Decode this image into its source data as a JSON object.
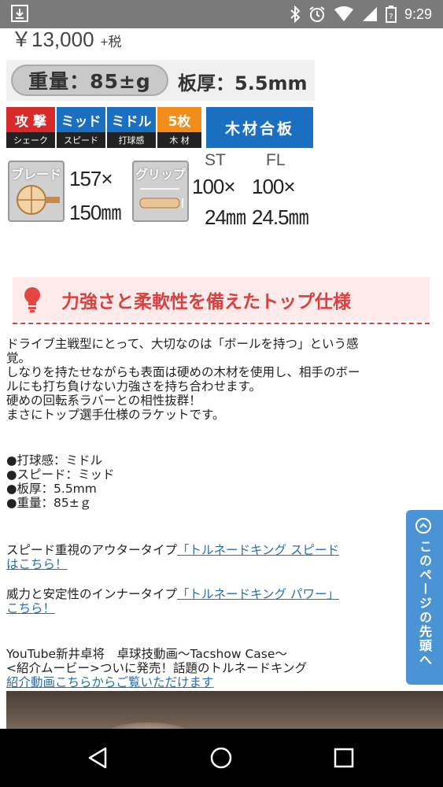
{
  "status_bar": {
    "time": "9:29"
  },
  "product": {
    "price": "￥13,000",
    "tax": "+税"
  },
  "spec": {
    "weight": "重量：85±g",
    "thickness": "板厚：5.5mm",
    "badges": [
      {
        "top": "攻 撃",
        "bottom": "シェーク"
      },
      {
        "top": "ミッド",
        "bottom": "スピード"
      },
      {
        "top": "ミドル",
        "bottom": "打球感"
      },
      {
        "top": "5枚",
        "bottom": "木 材"
      }
    ],
    "wood_label": "木材合板",
    "blade_label": "ブレード",
    "blade_w": "157×",
    "blade_h": "150㎜",
    "grip_label": "グリップ",
    "st_label": "ST",
    "fl_label": "FL",
    "st_w": "100×",
    "st_h": "24㎜",
    "fl_w": "100×",
    "fl_h": "24.5㎜"
  },
  "heading": {
    "title": "力強さと柔軟性を備えたトップ仕様"
  },
  "description": [
    "ドライブ主戦型にとって、大切なのは「ボールを持つ」という感",
    "覚。",
    "しなりを持たせながらも表面は硬めの木材を使用し、相手のボー",
    "ルにも打ち負けない力強さを持ち合わせます。",
    "硬めの回転系ラバーとの相性抜群！",
    "まさにトップ選手仕様のラケットです。"
  ],
  "specs_list": [
    "●打球感：ミドル",
    "●スピード：ミッド",
    "●板厚：5.5mm",
    "●重量：85±ｇ"
  ],
  "links": {
    "speed_prefix": "スピード重視のアウタータイプ",
    "speed_link_1": "「トルネードキング スピード",
    "speed_link_2": "はこちら！",
    "power_prefix": "威力と安定性のインナータイプ",
    "power_link_1": "「トルネードキング パワー」",
    "power_link_2": "こちら！"
  },
  "video": {
    "line1": "YouTube新井卓将　卓球技動画〜Tacshow Case〜",
    "line2": "<紹介ムービー>ついに発売！話題のトルネードキング",
    "link": "紹介動画こちらからご覧いただけます"
  },
  "side_tab": {
    "label": "このページの先頭へ"
  },
  "colors": {
    "accent_red": "#d94040",
    "link_blue": "#2a6db0",
    "tab_blue": "#4a94d6"
  }
}
